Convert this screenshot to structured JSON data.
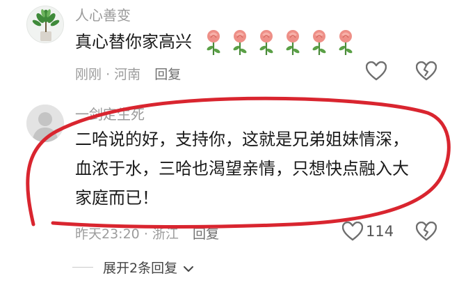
{
  "comments": [
    {
      "username": "人心善变",
      "text": "真心替你家高兴",
      "meta_time": "刚刚",
      "meta_location": "河南",
      "reply_label": "回复",
      "like_count": ""
    },
    {
      "username": "一剑定生死",
      "text_lines": [
        "二哈说的好，支持你，这就是兄弟姐妹情深，",
        "血浓于水，三哈也渴望亲情，只想快点融入大",
        "家庭而已！"
      ],
      "meta_time": "昨天23:20",
      "meta_location": "浙江",
      "reply_label": "回复",
      "like_count": "114"
    }
  ],
  "expand_label": "展开2条回复",
  "colors": {
    "annotation_red": "#d9252f",
    "text_primary": "#1a1a1a",
    "text_muted": "#9c9c9c"
  },
  "icons": [
    "heart-outline-icon",
    "broken-heart-icon",
    "chevron-down-icon",
    "rose-emoji-icon"
  ]
}
